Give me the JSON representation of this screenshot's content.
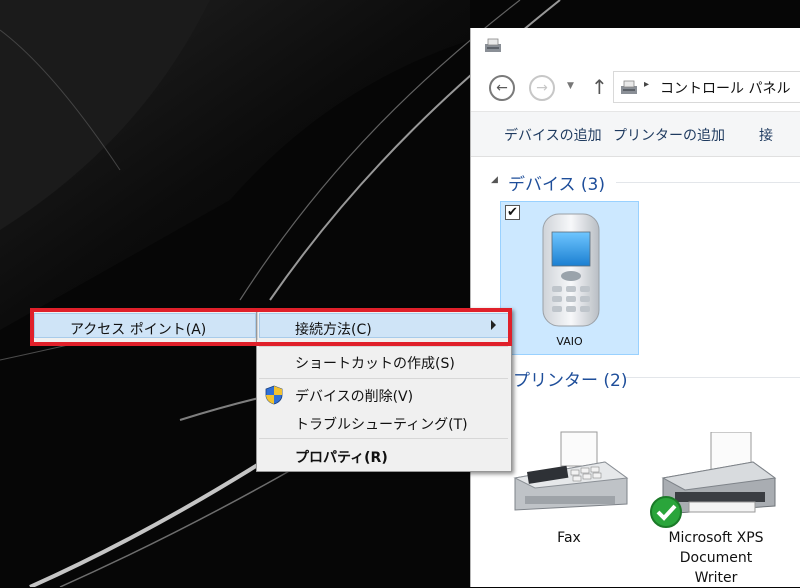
{
  "window": {
    "address": {
      "separator": "▸",
      "path": "コントロール パネル"
    },
    "nav": {
      "back_glyph": "←",
      "forward_glyph": "→",
      "dropdown_glyph": "▼",
      "up_glyph": "↑"
    },
    "commands": {
      "add_device": "デバイスの追加",
      "add_printer": "プリンターの追加",
      "overflow": "接"
    },
    "groups": {
      "devices": {
        "title": "デバイス (3)",
        "items": [
          {
            "label": "VAIO",
            "checked": "✔"
          }
        ]
      },
      "printers": {
        "title": "プリンター (2)",
        "items": [
          {
            "label": "Fax"
          },
          {
            "label": "Microsoft XPS Document Writer"
          }
        ]
      }
    },
    "colors": {
      "accent": "#1e4e9a",
      "selection": "#cce8ff"
    }
  },
  "context_menu": {
    "left_item": "アクセス ポイント(A)",
    "connect_via": "接続方法(C)",
    "create_shortcut": "ショートカットの作成(S)",
    "remove_device": "デバイスの削除(V)",
    "troubleshoot": "トラブルシューティング(T)",
    "properties": "プロパティ(R)",
    "highlight_color": "#e0202a"
  },
  "icons": [
    "printer-folder-icon",
    "back-arrow-icon",
    "forward-arrow-icon",
    "up-arrow-icon",
    "mobile-phone-icon",
    "fax-icon",
    "printer-icon",
    "check-badge-icon",
    "uac-shield-icon",
    "submenu-arrow-icon"
  ]
}
